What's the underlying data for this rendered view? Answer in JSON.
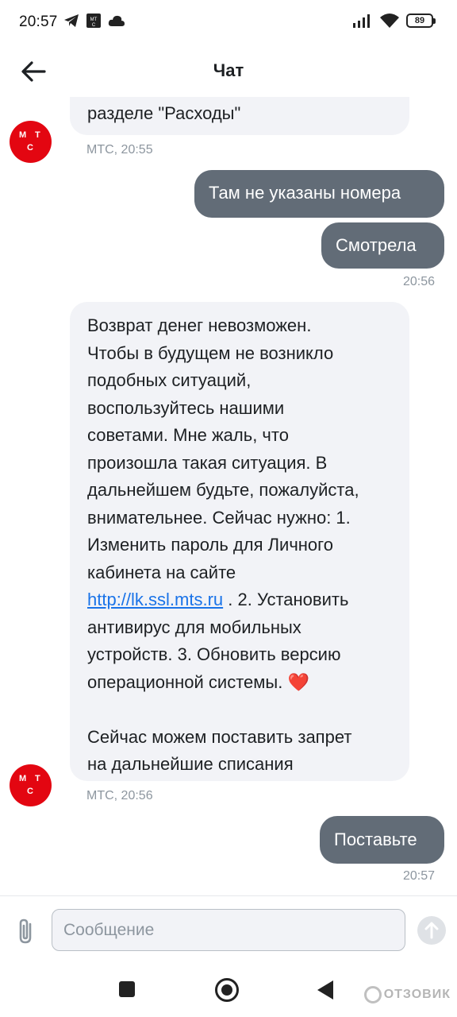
{
  "status_bar": {
    "time": "20:57",
    "battery": "89",
    "icons": [
      "telegram-icon",
      "mts-app-icon",
      "cloud-icon",
      "signal-icon",
      "wifi-icon",
      "battery-icon"
    ]
  },
  "header": {
    "title": "Чат",
    "back_icon": "arrow-left-icon"
  },
  "messages": [
    {
      "direction": "in",
      "text": "разделе \"Расходы\"",
      "meta": "МТС, 20:55"
    },
    {
      "direction": "out",
      "text": "Там не указаны номера"
    },
    {
      "direction": "out",
      "text": "Смотрела",
      "time": "20:56"
    },
    {
      "direction": "in",
      "lines": [
        "Возврат денег невозможен.",
        "Чтобы в будущем не возникло",
        "подобных ситуаций,",
        "воспользуйтесь нашими",
        "советами. Мне жаль, что",
        "произошла такая ситуация. В",
        "дальнейшем будьте, пожалуйста,",
        "внимательнее. Сейчас нужно: 1.",
        "Изменить пароль для Личного",
        "кабинета на сайте"
      ],
      "link": "http://lk.ssl.mts.ru",
      "after_link": " . 2. Установить",
      "lines2": [
        "антивирус для мобильных",
        "устройств. 3. Обновить версию"
      ],
      "last_line": "операционной системы.",
      "emoji": "❤️",
      "lines3": [
        "Сейчас можем поставить запрет",
        "на дальнейшие списания"
      ],
      "meta": "МТС, 20:56"
    },
    {
      "direction": "out",
      "text": "Поставьте",
      "time": "20:57"
    }
  ],
  "avatar": {
    "letters": [
      "М",
      "Т",
      "С"
    ],
    "color": "#e30611"
  },
  "input": {
    "placeholder": "Сообщение",
    "value": ""
  },
  "colors": {
    "incoming_bubble": "#f2f3f7",
    "outgoing_bubble": "#626c77",
    "link": "#1a73e8",
    "meta": "#8d969f"
  },
  "watermark": "ОТЗОВИК"
}
